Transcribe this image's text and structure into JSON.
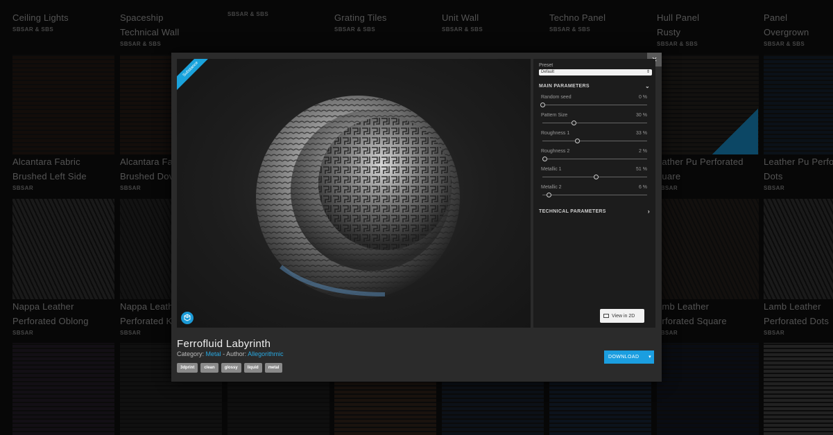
{
  "background": {
    "columns": [
      {
        "title1": "Ceiling Lights",
        "title2": "",
        "tag": "SBSAR & SBS",
        "r1_title1": "Alcantara Fabric",
        "r1_title2": "Brushed Left Side",
        "r1_tag": "SBSAR",
        "r2_title1": "Nappa Leather",
        "r2_title2": "Perforated Oblong",
        "r2_tag": "SBSAR"
      },
      {
        "title1": "Spaceship",
        "title2": "Technical Wall",
        "tag": "SBSAR & SBS",
        "r1_title1": "Alcantara Fa",
        "r1_title2": "Brushed Dov",
        "r1_tag": "SBSAR",
        "r2_title1": "Nappa Leath",
        "r2_title2": "Perforated K",
        "r2_tag": "SBSAR"
      },
      {
        "title1": "",
        "title2": "",
        "tag": "SBSAR & SBS",
        "r1_title1": "",
        "r1_title2": "",
        "r1_tag": "",
        "r2_title1": "",
        "r2_title2": "",
        "r2_tag": ""
      },
      {
        "title1": "Grating Tiles",
        "title2": "",
        "tag": "SBSAR & SBS",
        "r1_title1": "",
        "r1_title2": "",
        "r1_tag": "",
        "r2_title1": "",
        "r2_title2": "",
        "r2_tag": ""
      },
      {
        "title1": "Unit Wall",
        "title2": "",
        "tag": "SBSAR & SBS",
        "r1_title1": "",
        "r1_title2": "",
        "r1_tag": "",
        "r2_title1": "",
        "r2_title2": "",
        "r2_tag": ""
      },
      {
        "title1": "Techno Panel",
        "title2": "",
        "tag": "SBSAR & SBS",
        "r1_title1": "",
        "r1_title2": "",
        "r1_tag": "",
        "r2_title1": "",
        "r2_title2": "",
        "r2_tag": ""
      },
      {
        "title1": "Hull Panel",
        "title2": "Rusty",
        "tag": "SBSAR & SBS",
        "r1_title1": "eather Pu Perforated",
        "r1_title2": "quare",
        "r1_tag": "SBSAR",
        "r2_title1": "amb Leather",
        "r2_title2": "erforated Square",
        "r2_tag": "SBSAR"
      },
      {
        "title1": "Panel",
        "title2": "Overgrown",
        "tag": "SBSAR & SBS",
        "r1_title1": "Leather Pu Perfo",
        "r1_title2": "Dots",
        "r1_tag": "SBSAR",
        "r2_title1": "Lamb Leather",
        "r2_title2": "Perforated Dots",
        "r2_tag": "SBSAR"
      }
    ]
  },
  "modal": {
    "close": "×",
    "ribbon": "Substance",
    "preset_label": "Preset",
    "preset_value": "Default",
    "main_parameters": "MAIN PARAMETERS",
    "technical_parameters": "TECHNICAL PARAMETERS",
    "params": [
      {
        "label": "Random seed",
        "value": "0 %",
        "level": 0
      },
      {
        "label": "Pattern Size",
        "value": "30 %",
        "level": 0.3
      },
      {
        "label": "Roughness 1",
        "value": "33 %",
        "level": 0.33
      },
      {
        "label": "Roughness 2",
        "value": "2 %",
        "level": 0.02
      },
      {
        "label": "Metallic 1",
        "value": "51 %",
        "level": 0.51
      },
      {
        "label": "Metallic 2",
        "value": "6 %",
        "level": 0.06
      }
    ],
    "view2d": "View in 2D",
    "title": "Ferrofluid Labyrinth",
    "category_label": "Category:",
    "category": "Metal",
    "author_label": "- Author:",
    "author": "Allegorithmic",
    "tags": [
      "3dprint",
      "clean",
      "glossy",
      "liquid",
      "metal"
    ],
    "download": "DOWNLOAD"
  },
  "colors": {
    "accent": "#1b9ee0",
    "modal_bg": "#2b2b2b",
    "panel_bg": "#1c1c1c"
  }
}
